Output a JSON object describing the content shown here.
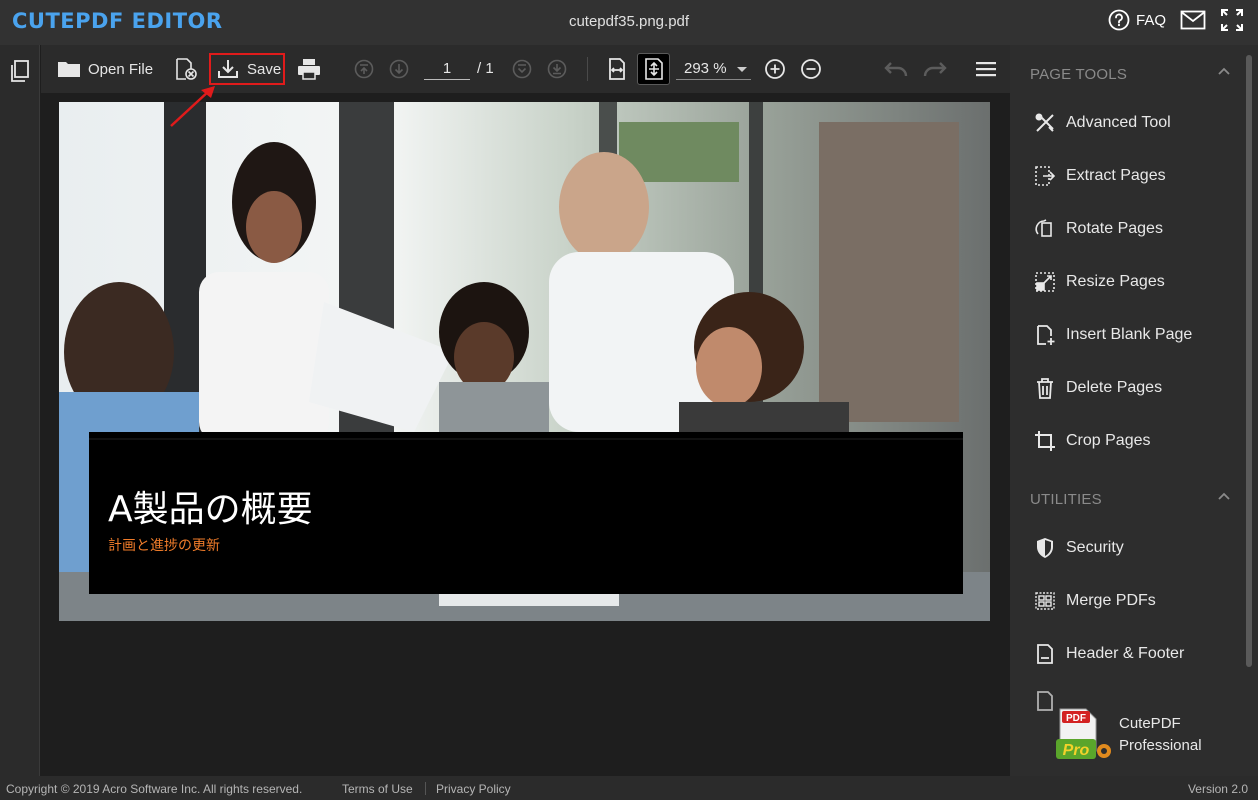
{
  "app": {
    "brand": "CUTEPDF EDITOR",
    "doc_title": "cutepdf35.png.pdf"
  },
  "titlebar": {
    "faq_label": "FAQ",
    "icons": [
      "help-icon",
      "mail-icon",
      "fullscreen-icon"
    ]
  },
  "toolbar": {
    "open_label": "Open File",
    "save_label": "Save",
    "page_current": "1",
    "page_total": "/ 1",
    "zoom": "293 %",
    "icons": [
      "folder-icon",
      "close-file-icon",
      "download-icon",
      "print-icon",
      "first-page-icon",
      "prev-page-icon",
      "next-page-icon",
      "last-page-icon",
      "fit-width-icon",
      "fit-page-icon",
      "zoom-in-icon",
      "zoom-out-icon",
      "undo-icon",
      "redo-icon",
      "menu-icon"
    ]
  },
  "slide": {
    "title": "A製品の概要",
    "subtitle": "計画と進捗の更新"
  },
  "panel": {
    "page_tools_heading": "PAGE TOOLS",
    "page_tools": [
      {
        "label": "Advanced Tool",
        "icon": "tools-icon"
      },
      {
        "label": "Extract Pages",
        "icon": "extract-pages-icon"
      },
      {
        "label": "Rotate Pages",
        "icon": "rotate-pages-icon"
      },
      {
        "label": "Resize Pages",
        "icon": "resize-pages-icon"
      },
      {
        "label": "Insert Blank Page",
        "icon": "insert-page-icon"
      },
      {
        "label": "Delete Pages",
        "icon": "trash-icon"
      },
      {
        "label": "Crop Pages",
        "icon": "crop-icon"
      }
    ],
    "utilities_heading": "UTILITIES",
    "utilities": [
      {
        "label": "Security",
        "icon": "shield-icon"
      },
      {
        "label": "Merge PDFs",
        "icon": "merge-icon"
      },
      {
        "label": "Header & Footer",
        "icon": "header-footer-icon"
      }
    ],
    "promo": {
      "line1": "CutePDF",
      "line2": "Professional",
      "badge": "PDF",
      "badge2": "Pro"
    }
  },
  "footer": {
    "copyright": "Copyright © 2019 Acro Software Inc. All rights reserved.",
    "terms": "Terms of Use",
    "privacy": "Privacy Policy",
    "version": "Version 2.0"
  },
  "colors": {
    "brand": "#4aa3ee",
    "highlight": "#e01b1b",
    "subtitle": "#f07c2a"
  }
}
